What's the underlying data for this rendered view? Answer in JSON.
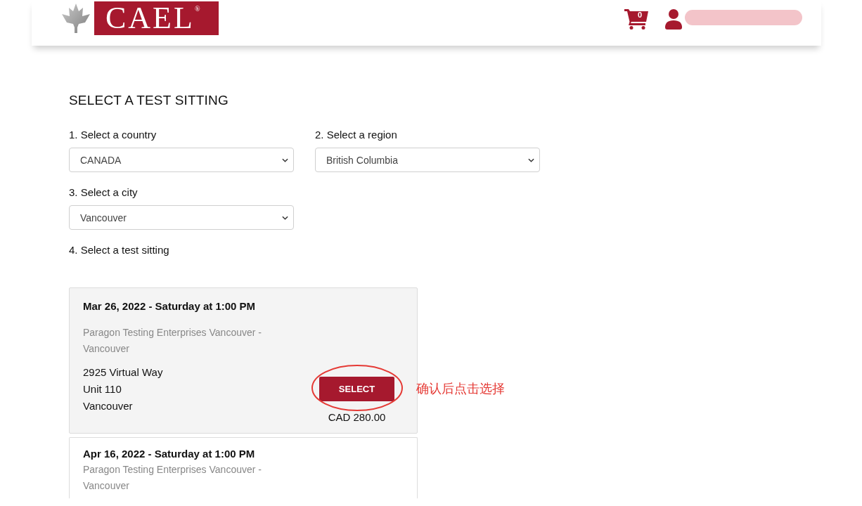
{
  "header": {
    "logo": "CAEL$^{®}$",
    "cart_count": "0"
  },
  "heading": "SELECT A TEST SITTING",
  "fields": [
    {
      "label": "1. Select a country",
      "value": "CANADA"
    },
    {
      "label": "2. Select a region",
      "value": "British Columbia"
    },
    {
      "label": "3. Select a city",
      "value": "Vancouver"
    }
  ],
  "sitting_prompt": "4. Select a test sitting",
  "sittings": [
    {
      "hovered": true,
      "datetime": "Mar 26, 2022 - Saturday at 1:00 PM",
      "venue": "Paragon Testing Enterprises Vancouver - Vancouver",
      "address": [
        "2925 Virtual Way",
        "Unit 110",
        "Vancouver"
      ],
      "button": "SELECT",
      "price": "CAD 280.00",
      "annotation": "确认后点击选择"
    },
    {
      "hovered": false,
      "datetime": "Apr 16, 2022 - Saturday at 1:00 PM",
      "venue": "Paragon Testing Enterprises Vancouver - Vancouver"
    }
  ]
}
